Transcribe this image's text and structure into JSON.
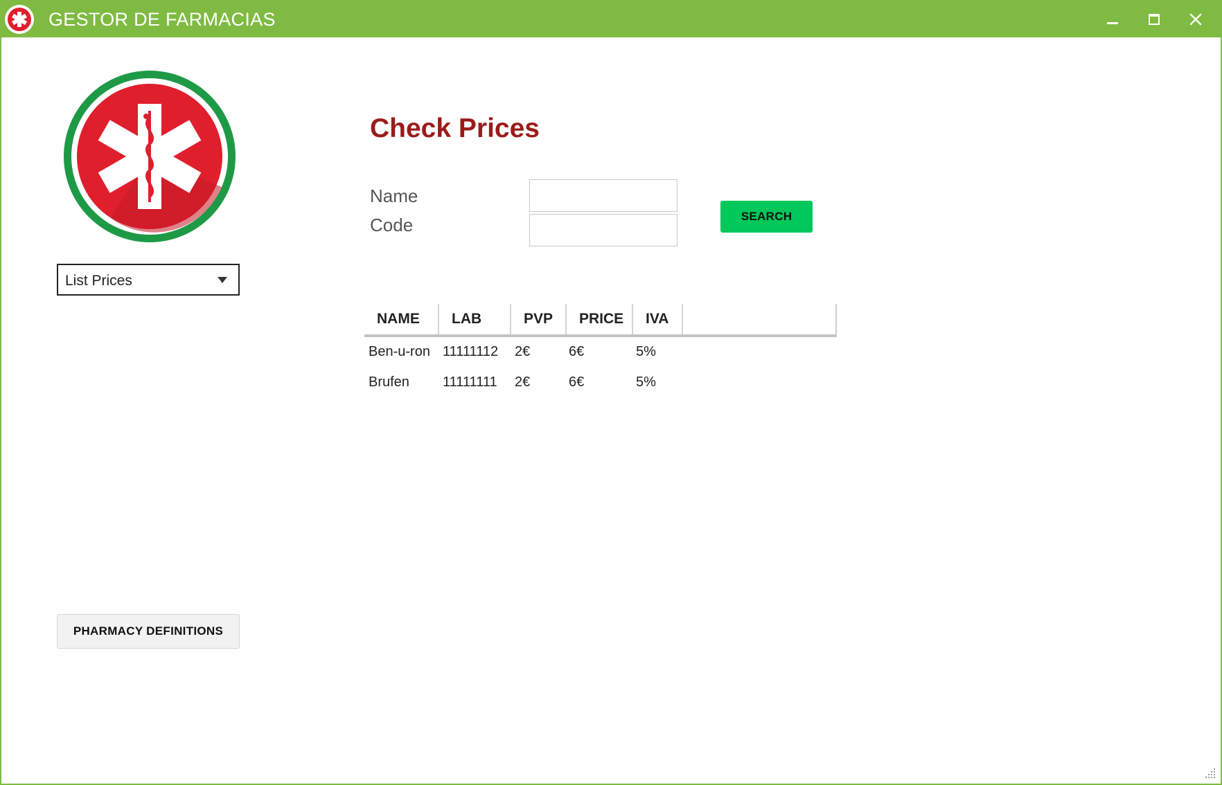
{
  "window": {
    "title": "GESTOR DE FARMACIAS",
    "accent_color": "#7fba42"
  },
  "sidebar": {
    "logo_icon": "star-of-life-icon",
    "view_select": {
      "selected": "List Prices"
    },
    "pharmacy_definitions_label": "PHARMACY DEFINITIONS"
  },
  "main": {
    "heading": "Check Prices",
    "heading_color": "#9b1b1b",
    "form": {
      "name_label": "Name",
      "name_value": "",
      "code_label": "Code",
      "code_value": "",
      "search_label": "SEARCH",
      "search_color": "#00c85a"
    },
    "table": {
      "columns": [
        "NAME",
        "LAB",
        "PVP",
        "PRICE",
        "IVA"
      ],
      "rows": [
        {
          "name": "Ben-u-ron",
          "lab": "11111112",
          "pvp": "2€",
          "price": "6€",
          "iva": "5%"
        },
        {
          "name": "Brufen",
          "lab": "11111111",
          "pvp": "2€",
          "price": "6€",
          "iva": "5%"
        }
      ]
    }
  }
}
